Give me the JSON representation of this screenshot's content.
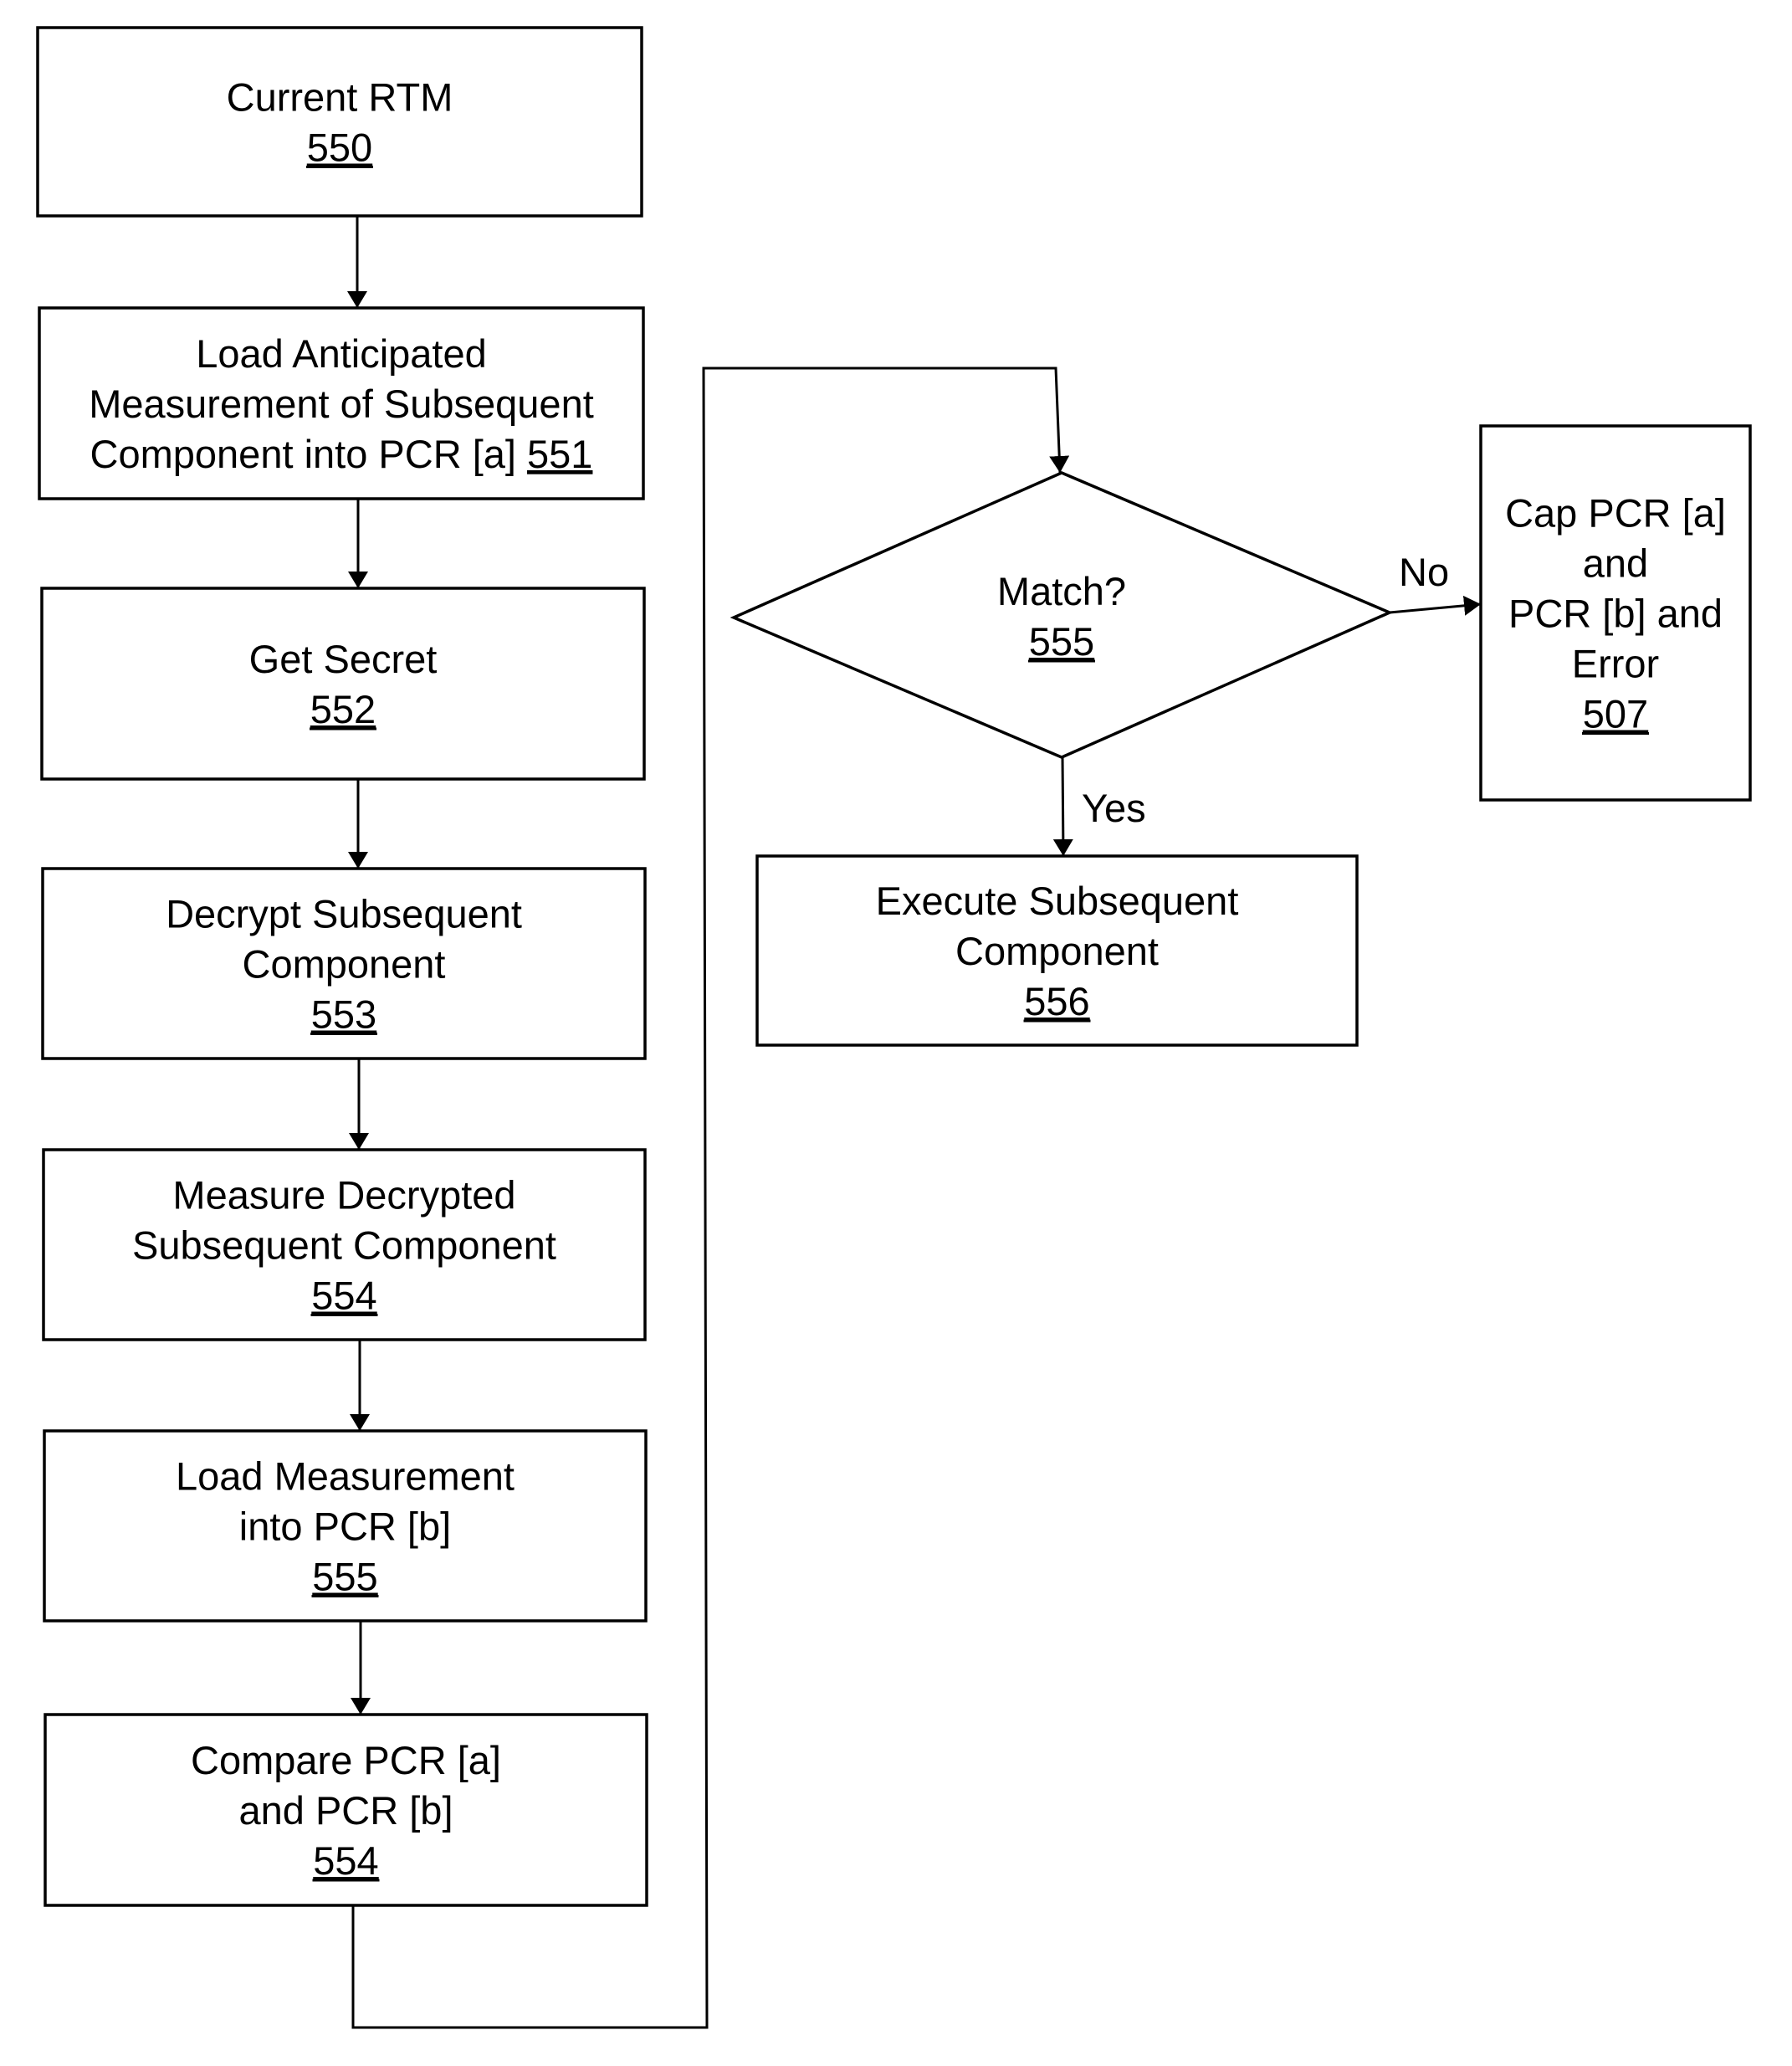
{
  "diagram": {
    "type": "flowchart",
    "colors": {
      "stroke": "#000000",
      "fill": "#ffffff",
      "text": "#000000"
    },
    "nodes": [
      {
        "id": "n550",
        "shape": "process",
        "lines": [
          "Current RTM"
        ],
        "ref": "550"
      },
      {
        "id": "n551",
        "shape": "process",
        "lines": [
          "Load Anticipated",
          "Measurement of Subsequent",
          "Component into PCR [a]"
        ],
        "ref": "551",
        "ref_inline": true
      },
      {
        "id": "n552",
        "shape": "process",
        "lines": [
          "Get Secret"
        ],
        "ref": "552"
      },
      {
        "id": "n553",
        "shape": "process",
        "lines": [
          "Decrypt Subsequent",
          "Component"
        ],
        "ref": "553"
      },
      {
        "id": "n554a",
        "shape": "process",
        "lines": [
          "Measure Decrypted",
          "Subsequent Component"
        ],
        "ref": "554"
      },
      {
        "id": "n555b",
        "shape": "process",
        "lines": [
          "Load Measurement",
          "into PCR [b]"
        ],
        "ref": "555"
      },
      {
        "id": "n554c",
        "shape": "process",
        "lines": [
          "Compare PCR [a]",
          "and PCR [b]"
        ],
        "ref": "554"
      },
      {
        "id": "n555d",
        "shape": "decision",
        "lines": [
          "Match?"
        ],
        "ref": "555"
      },
      {
        "id": "n556",
        "shape": "process",
        "lines": [
          "Execute Subsequent",
          "Component"
        ],
        "ref": "556"
      },
      {
        "id": "n507",
        "shape": "process",
        "lines": [
          "Cap PCR [a]",
          "and",
          "PCR [b] and",
          "Error"
        ],
        "ref": "507"
      }
    ],
    "edges": [
      {
        "from": "n550",
        "to": "n551",
        "label": ""
      },
      {
        "from": "n551",
        "to": "n552",
        "label": ""
      },
      {
        "from": "n552",
        "to": "n553",
        "label": ""
      },
      {
        "from": "n553",
        "to": "n554a",
        "label": ""
      },
      {
        "from": "n554a",
        "to": "n555b",
        "label": ""
      },
      {
        "from": "n555b",
        "to": "n554c",
        "label": ""
      },
      {
        "from": "n554c",
        "to": "n555d",
        "label": ""
      },
      {
        "from": "n555d",
        "to": "n507",
        "label": "No"
      },
      {
        "from": "n555d",
        "to": "n556",
        "label": "Yes"
      }
    ]
  }
}
